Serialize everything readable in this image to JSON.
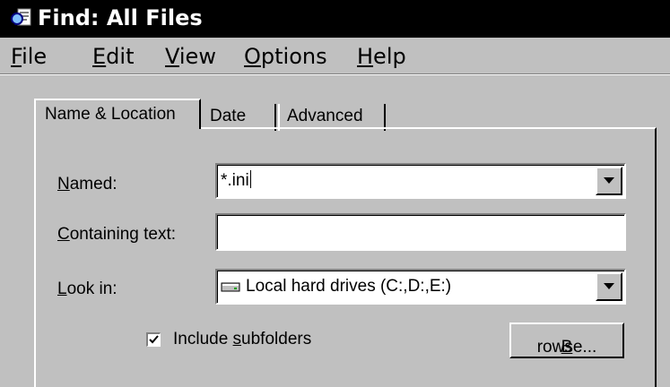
{
  "window": {
    "title": "Find: All Files",
    "icon": "find-files-icon"
  },
  "menu": [
    {
      "key": "F",
      "rest": "ile"
    },
    {
      "key": "E",
      "rest": "dit"
    },
    {
      "key": "V",
      "rest": "iew"
    },
    {
      "key": "O",
      "rest": "ptions"
    },
    {
      "key": "H",
      "rest": "elp"
    }
  ],
  "tabs": {
    "name_location": "Name & Location",
    "date": "Date",
    "advanced": "Advanced",
    "active": "Name & Location"
  },
  "form": {
    "named": {
      "label_key": "N",
      "label_rest": "amed:",
      "value": "*.ini"
    },
    "containing": {
      "label_key": "C",
      "label_rest": "ontaining text:",
      "value": ""
    },
    "look_in": {
      "label_key": "L",
      "label_rest": "ook in:",
      "value": "Local hard drives (C:,D:,E:)",
      "icon": "hard-drive-icon"
    },
    "include_subfolders": {
      "pre": "Include ",
      "key": "s",
      "post": "ubfolders",
      "checked": true
    },
    "browse": {
      "key": "B",
      "rest": "rowse..."
    }
  }
}
